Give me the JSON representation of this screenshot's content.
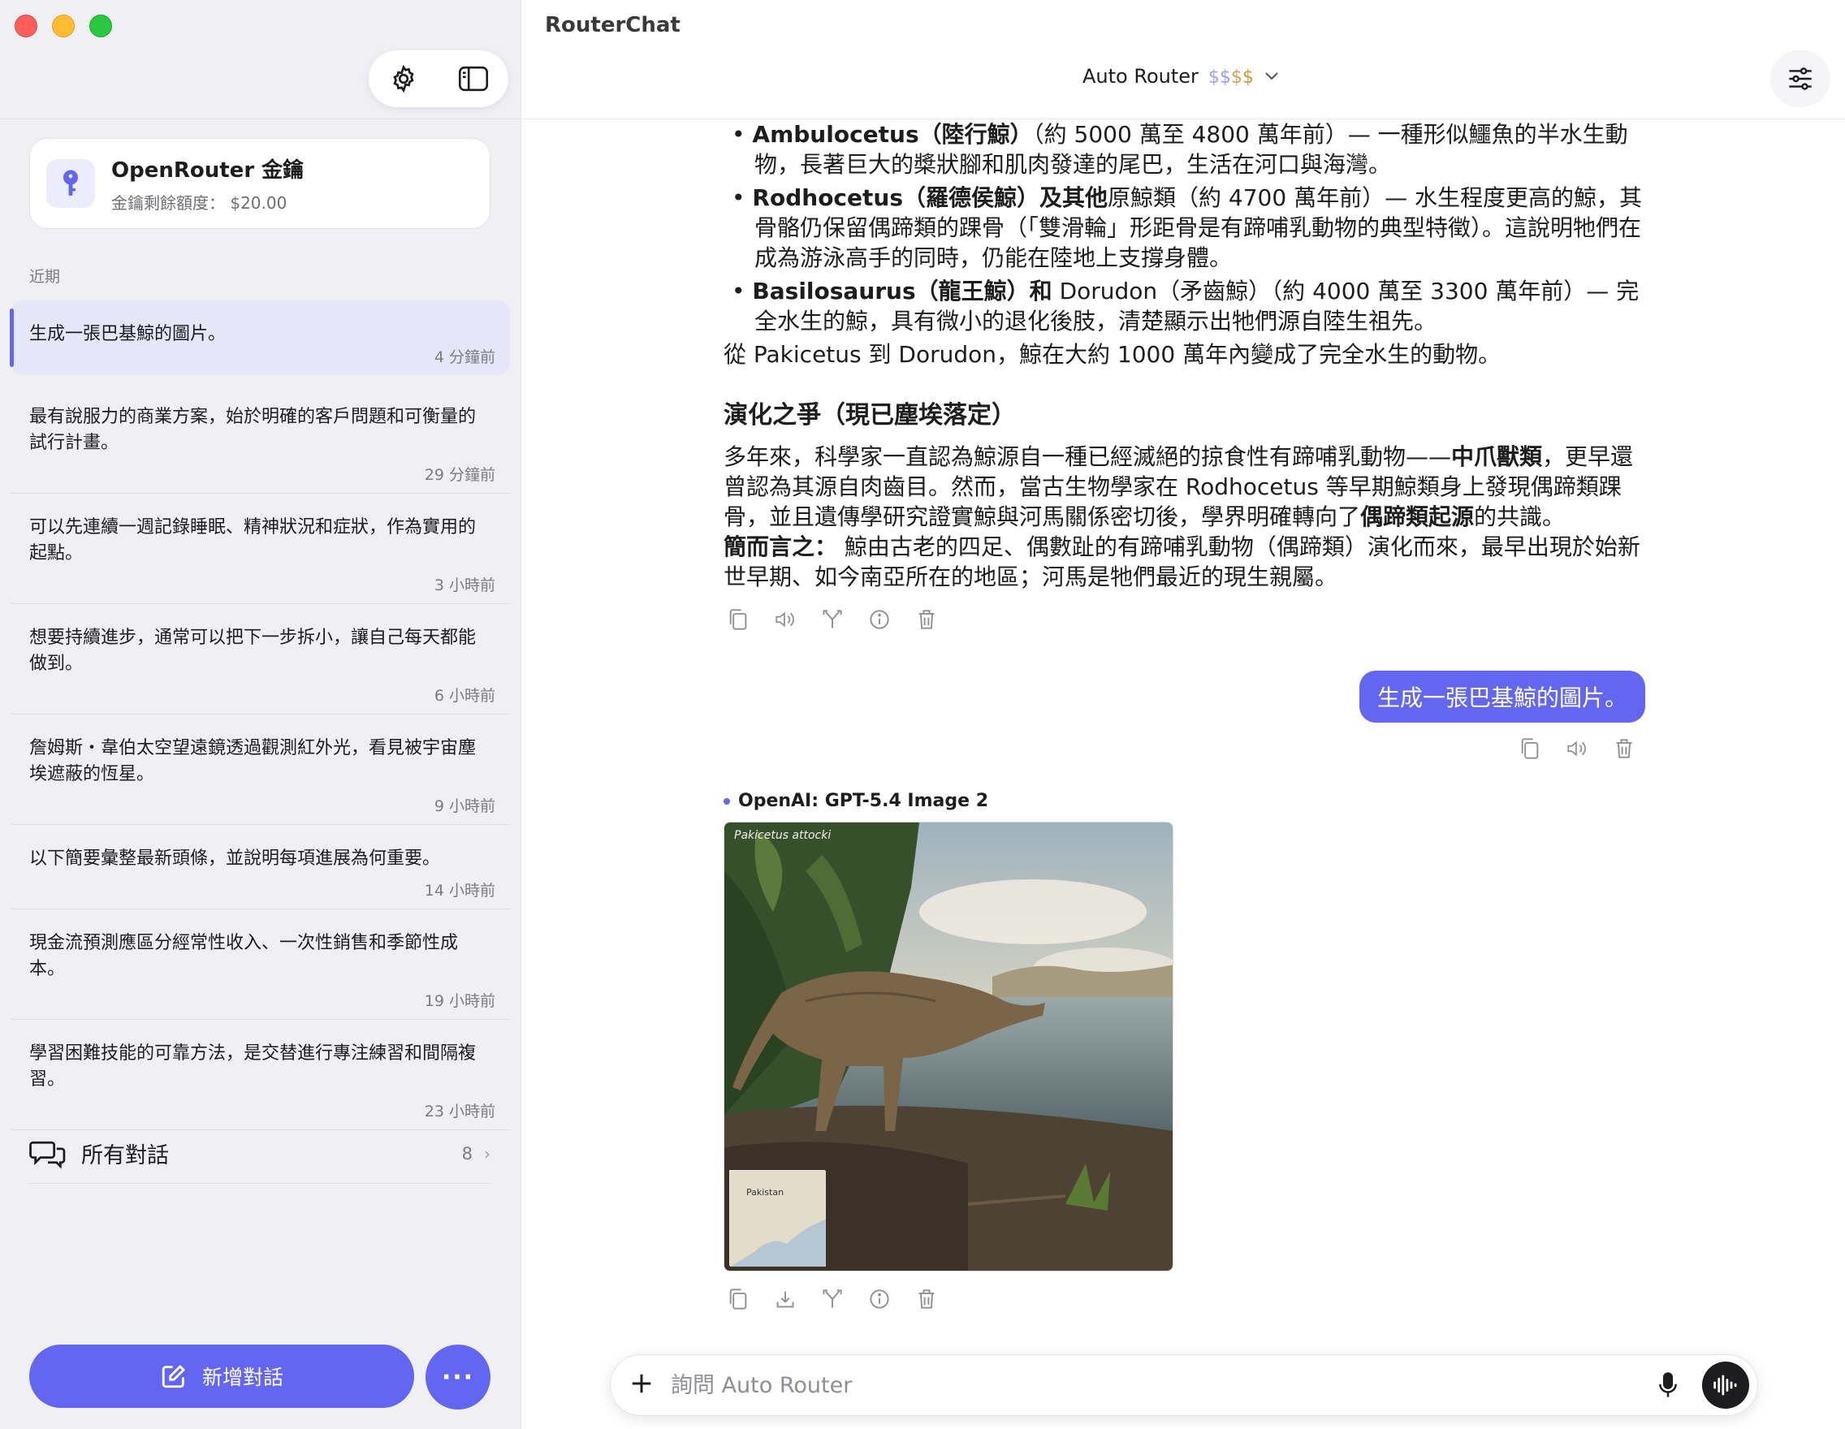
{
  "sidebar": {
    "key_card": {
      "title": "OpenRouter 金鑰",
      "subtitle": "金鑰剩餘額度： $20.00"
    },
    "section_label": "近期",
    "recent": [
      {
        "title": "生成一張巴基鯨的圖片。",
        "time": "4 分鐘前"
      },
      {
        "title": "最有說服力的商業方案，始於明確的客戶問題和可衡量的試行計畫。",
        "time": "29 分鐘前"
      },
      {
        "title": "可以先連續一週記錄睡眠、精神狀況和症狀，作為實用的起點。",
        "time": "3 小時前"
      },
      {
        "title": "想要持續進步，通常可以把下一步拆小，讓自己每天都能做到。",
        "time": "6 小時前"
      },
      {
        "title": "詹姆斯・韋伯太空望遠鏡透過觀測紅外光，看見被宇宙塵埃遮蔽的恆星。",
        "time": "9 小時前"
      },
      {
        "title": "以下簡要彙整最新頭條，並說明每項進展為何重要。",
        "time": "14 小時前"
      },
      {
        "title": "現金流預測應區分經常性收入、一次性銷售和季節性成本。",
        "time": "19 小時前"
      },
      {
        "title": "學習困難技能的可靠方法，是交替進行專注練習和間隔複習。",
        "time": "23 小時前"
      }
    ],
    "all_conversations": {
      "label": "所有對話",
      "count": "8"
    },
    "new_chat_label": "新增對話",
    "more_label": "···"
  },
  "main": {
    "app_title": "RouterChat",
    "model": {
      "name": "Auto Router",
      "price": [
        "$",
        "$",
        "$",
        "$"
      ]
    },
    "assistant_text": {
      "bullets": [
        {
          "bold": "Ambulocetus（陸行鯨）",
          "rest": "（約 5000 萬至 4800 萬年前）— 一種形似鱷魚的半水生動物，長著巨大的槳狀腳和肌肉發達的尾巴，生活在河口與海灣。"
        },
        {
          "bold": "Rodhocetus（羅德侯鯨）及其他",
          "rest": "原鯨類（約 4700 萬年前）— 水生程度更高的鯨，其骨骼仍保留偶蹄類的踝骨（「雙滑輪」形距骨是有蹄哺乳動物的典型特徵）。這說明牠們在成為游泳高手的同時，仍能在陸地上支撐身體。"
        },
        {
          "bold": "Basilosaurus（龍王鯨）和",
          "rest": " Dorudon（矛齒鯨）（約 4000 萬至 3300 萬年前）— 完全水生的鯨，具有微小的退化後肢，清楚顯示出牠們源自陸生祖先。"
        }
      ],
      "summary": "從 Pakicetus 到 Dorudon，鯨在大約 1000 萬年內變成了完全水生的動物。",
      "heading": "演化之爭（現已塵埃落定）",
      "para1_a": "多年來，科學家一直認為鯨源自一種已經滅絕的掠食性有蹄哺乳動物——",
      "para1_b": "中爪獸類",
      "para1_c": "，更早還曾認為其源自肉齒目。然而，當古生物學家在 Rodhocetus 等早期鯨類身上發現偶蹄類踝骨，並且遺傳學研究證實鯨與河馬關係密切後，學界明確轉向了",
      "para1_d": "偶蹄類起源",
      "para1_e": "的共識。",
      "para2_bold": "簡而言之：",
      "para2_rest": " 鯨由古老的四足、偶數趾的有蹄哺乳動物（偶蹄類）演化而來，最早出現於始新世早期、如今南亞所在的地區；河馬是牠們最近的現生親屬。"
    },
    "user_message": "生成一張巴基鯨的圖片。",
    "image_model_label": "OpenAI: GPT-5.4 Image 2",
    "image": {
      "caption": "Pakicetus attocki",
      "map_label": "Pakistan"
    },
    "composer": {
      "placeholder": "詢問 Auto Router"
    }
  },
  "colors": {
    "accent": "#6366f1",
    "sidebar_bg": "#efeff4"
  }
}
